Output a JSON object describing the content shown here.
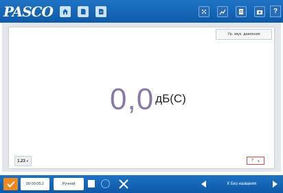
{
  "app": {
    "logo": "PASCO"
  },
  "toolbar": {
    "icons": [
      "home-icon",
      "document-icon",
      "file-icon"
    ],
    "right_icons": [
      "data-points-icon",
      "graph-tools-icon",
      "notes-icon",
      "camera-icon"
    ],
    "help_label": "?"
  },
  "main": {
    "sensor_button_label": "Ур. звук. давления",
    "meter_value": "0,0",
    "meter_unit": "дБ(С)",
    "precision_label": "1.23",
    "unit_select_value": "?"
  },
  "bottom": {
    "sample_rate": "00:00:05,2",
    "mode": "Ручной",
    "page_title": "К Без названия"
  },
  "colors": {
    "bar": "#1466b8",
    "value": "#8a78a8",
    "record": "#f08a1c"
  }
}
